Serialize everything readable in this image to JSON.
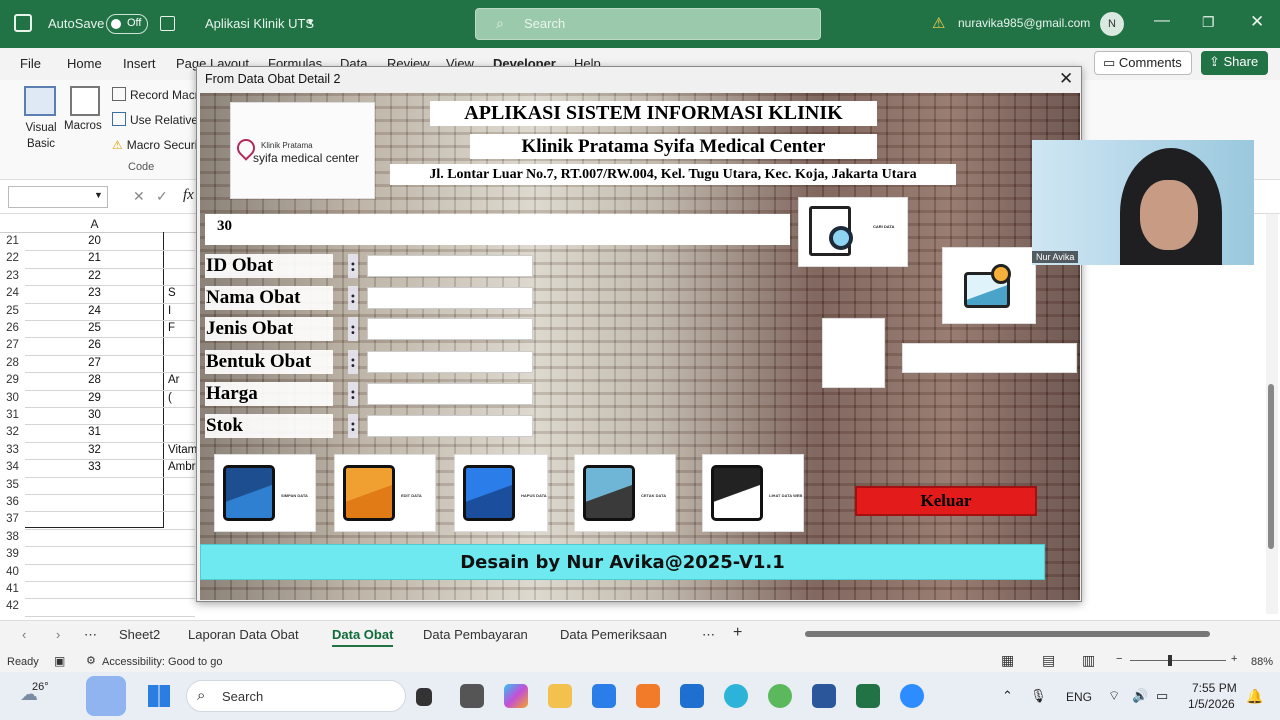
{
  "titlebar": {
    "autosave": "AutoSave",
    "toggle": "Off",
    "doc": "Aplikasi Klinik UTS",
    "search_placeholder": "Search",
    "email": "nuravika985@gmail.com",
    "avatar": "N"
  },
  "menu": {
    "items": [
      "File",
      "Home",
      "Insert",
      "Page Layout",
      "Formulas",
      "Data",
      "Review",
      "View",
      "Developer",
      "Help"
    ],
    "comments": "Comments",
    "share": "Share"
  },
  "ribbon": {
    "visual_basic": "Visual Basic",
    "macros": "Macros",
    "record_macro": "Record Macro",
    "use_relative": "Use Relative",
    "macro_security": "Macro Security",
    "group": "Code"
  },
  "formula": {
    "namebox": "",
    "fx": "fx"
  },
  "grid": {
    "col_header": "A",
    "rows": [
      {
        "r": "21",
        "a": "20",
        "b": ""
      },
      {
        "r": "22",
        "a": "21",
        "b": ""
      },
      {
        "r": "23",
        "a": "22",
        "b": ""
      },
      {
        "r": "24",
        "a": "23",
        "b": "S"
      },
      {
        "r": "25",
        "a": "24",
        "b": "I"
      },
      {
        "r": "26",
        "a": "25",
        "b": "F"
      },
      {
        "r": "27",
        "a": "26",
        "b": ""
      },
      {
        "r": "28",
        "a": "27",
        "b": ""
      },
      {
        "r": "29",
        "a": "28",
        "b": "Ar"
      },
      {
        "r": "30",
        "a": "29",
        "b": "("
      },
      {
        "r": "31",
        "a": "30",
        "b": ""
      },
      {
        "r": "32",
        "a": "31",
        "b": ""
      },
      {
        "r": "33",
        "a": "32",
        "b": "Vitam"
      },
      {
        "r": "34",
        "a": "33",
        "b": "Ambro"
      },
      {
        "r": "35",
        "a": "",
        "b": ""
      },
      {
        "r": "36",
        "a": "",
        "b": ""
      },
      {
        "r": "37",
        "a": "",
        "b": ""
      },
      {
        "r": "38",
        "a": "",
        "b": ""
      },
      {
        "r": "39",
        "a": "",
        "b": ""
      },
      {
        "r": "40",
        "a": "",
        "b": ""
      },
      {
        "r": "41",
        "a": "",
        "b": ""
      },
      {
        "r": "42",
        "a": "",
        "b": ""
      }
    ]
  },
  "form": {
    "title": "From Data Obat Detail 2",
    "logo": {
      "line1": "Klinik Pratama",
      "line2": "syifa medical center"
    },
    "header1": "APLIKASI SISTEM INFORMASI KLINIK",
    "header2": "Klinik Pratama Syifa Medical Center",
    "address": "Jl. Lontar Luar No.7, RT.007/RW.004, Kel. Tugu Utara, Kec. Koja, Jakarta Utara",
    "counter": "30",
    "fields": [
      {
        "label": "ID Obat",
        "value": ""
      },
      {
        "label": "Nama Obat",
        "value": ""
      },
      {
        "label": "Jenis Obat",
        "value": ""
      },
      {
        "label": "Bentuk Obat",
        "value": ""
      },
      {
        "label": "Harga",
        "value": ""
      },
      {
        "label": "Stok",
        "value": ""
      }
    ],
    "colon": ":",
    "buttons": [
      {
        "caption": "SIMPAN DATA",
        "icon": "save-folder-icon"
      },
      {
        "caption": "EDIT DATA",
        "icon": "edit-folder-icon"
      },
      {
        "caption": "HAPUS DATA",
        "icon": "delete-folder-icon"
      },
      {
        "caption": "CETAK DATA",
        "icon": "print-icon"
      },
      {
        "caption": "LIHAT DATA WEB",
        "icon": "view-data-icon"
      }
    ],
    "search_caption": "CARI DATA",
    "exit": "Keluar",
    "footer": "Desain by Nur Avika@2025-V1.1"
  },
  "webcam": {
    "name": "Nur Avika"
  },
  "tabs": {
    "items": [
      "Sheet2",
      "Laporan Data Obat",
      "Data Obat",
      "Data Pembayaran",
      "Data Pemeriksaan"
    ],
    "active": "Data Obat"
  },
  "status": {
    "ready": "Ready",
    "accessibility": "Accessibility: Good to go",
    "zoom": "88%"
  },
  "taskbar": {
    "temp": "26°",
    "search": "Search",
    "lang": "ENG",
    "time": "7:55 PM",
    "date": "1/5/2026"
  },
  "colors": {
    "excel_green": "#217346",
    "exit_red": "#e31b1b",
    "footer_cyan": "#6ee9ef"
  }
}
